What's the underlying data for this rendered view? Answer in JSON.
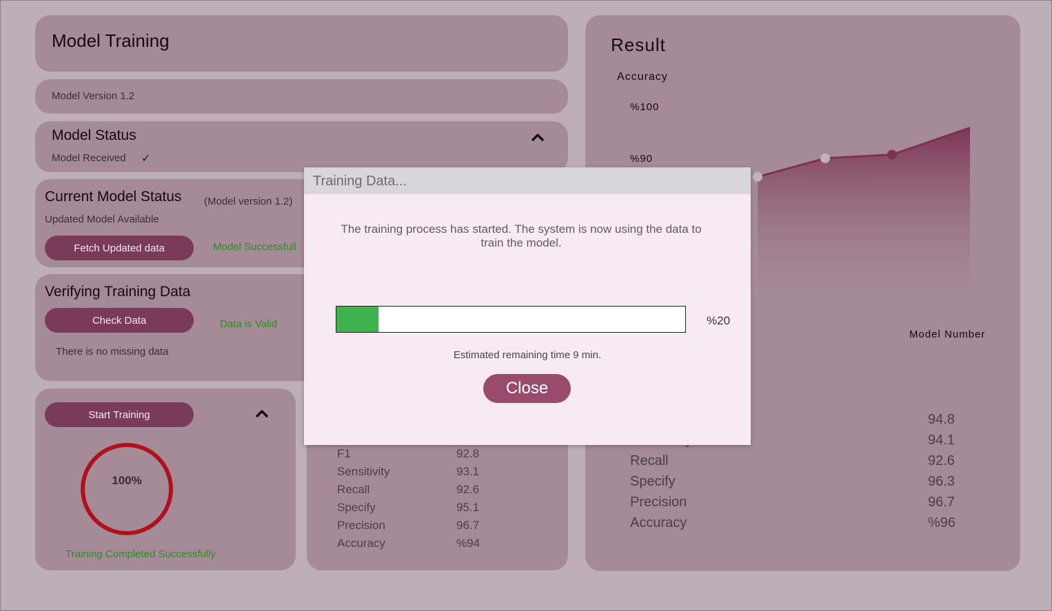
{
  "header": {
    "title": "Model Training"
  },
  "version_card": {
    "label": "Model Version 1.2"
  },
  "model_status": {
    "title": "Model Status",
    "status": "Model Received",
    "check_glyph": "✓"
  },
  "current_model": {
    "title": "Current Model Status",
    "version_note": "(Model version 1.2)",
    "subtitle": "Updated Model Available",
    "fetch_button": "Fetch Updated data",
    "success_msg": "Model Successfull"
  },
  "verify": {
    "title": "Verifying Training Data",
    "check_button": "Check Data",
    "valid_msg": "Data is Valid",
    "missing_msg": "There is no missing data"
  },
  "training": {
    "start_button": "Start Training",
    "ring_label": "100%",
    "ring_progress": 1.0,
    "completed_msg": "Training Completed Successfully"
  },
  "metrics_left": [
    {
      "name": "F1",
      "value": "92.8"
    },
    {
      "name": "Sensitivity",
      "value": "93.1"
    },
    {
      "name": "Recall",
      "value": "92.6"
    },
    {
      "name": "Specify",
      "value": "95.1"
    },
    {
      "name": "Precision",
      "value": "96.7"
    },
    {
      "name": "Accuracy",
      "value": "%94"
    }
  ],
  "result": {
    "title": "Result",
    "chart_data": {
      "type": "area",
      "ylabel": "Accuracy",
      "xlabel": "Model Number",
      "y_ticks": [
        "%100",
        "%90"
      ],
      "ylim": [
        70,
        100
      ],
      "points": [
        {
          "x": 1,
          "y": 86.3
        },
        {
          "x": 2,
          "y": 89.9
        },
        {
          "x": 3,
          "y": 90.6
        },
        {
          "x": 4,
          "y": 95.8
        }
      ]
    },
    "metrics": [
      {
        "name": "",
        "value": "94.8"
      },
      {
        "name": "Sensitivity",
        "value": "94.1"
      },
      {
        "name": "Recall",
        "value": "92.6"
      },
      {
        "name": "Specify",
        "value": "96.3"
      },
      {
        "name": "Precision",
        "value": "96.7"
      },
      {
        "name": "Accuracy",
        "value": "%96"
      }
    ]
  },
  "modal": {
    "title": "Training Data...",
    "message": "The training process has started. The system is now using the data to train the model.",
    "progress": 0.12,
    "progress_label": "%20",
    "eta": "Estimated remaining time 9 min.",
    "close_button": "Close"
  },
  "colors": {
    "background": "#bdaeb9",
    "card": "#a58b97",
    "button": "#7a3b5a",
    "success": "#2e8a28",
    "ring": "#b0121d",
    "progress_fill": "#3fb14f",
    "chart_line": "#7b3152"
  }
}
